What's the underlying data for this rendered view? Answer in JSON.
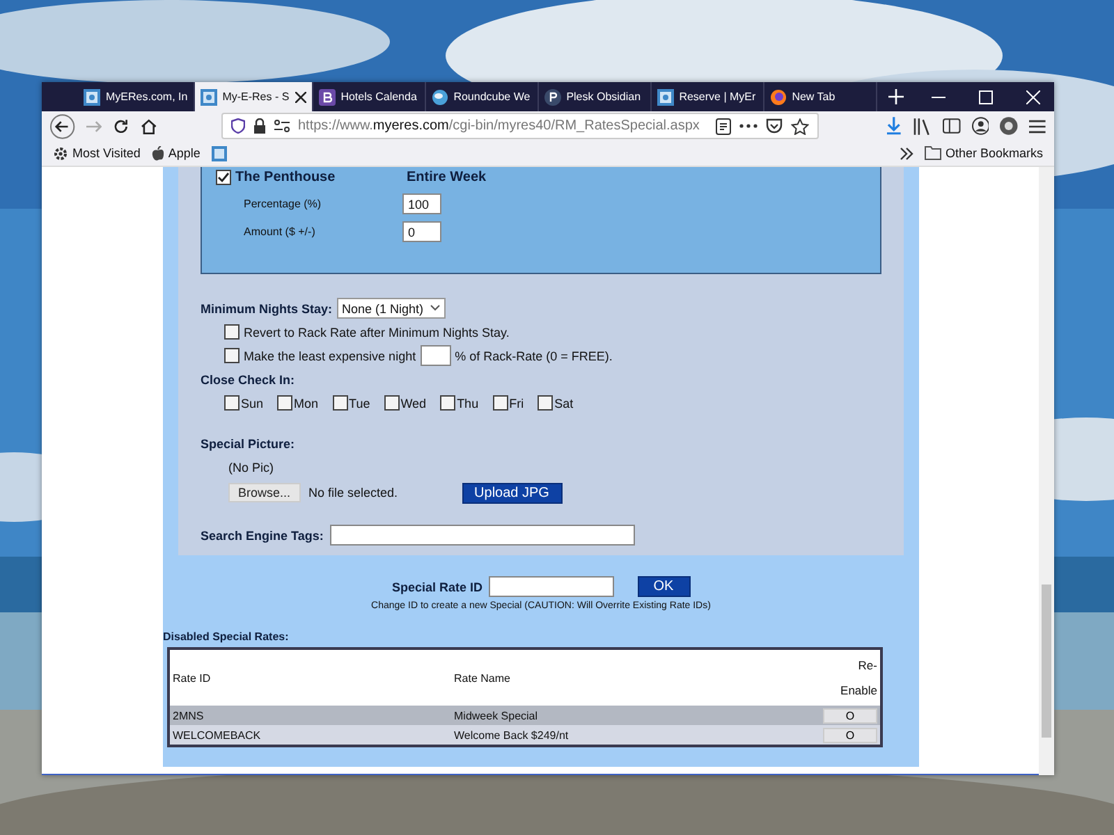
{
  "tabs": [
    {
      "title": "MyERes.com, In",
      "kind": "page",
      "selected": false
    },
    {
      "title": "My-E-Res - S",
      "kind": "page",
      "selected": true
    },
    {
      "title": "Hotels Calenda",
      "kind": "letter-b",
      "selected": false
    },
    {
      "title": "Roundcube We",
      "kind": "globe",
      "selected": false
    },
    {
      "title": "Plesk Obsidian",
      "kind": "letter-p",
      "selected": false
    },
    {
      "title": "Reserve | MyEr",
      "kind": "page",
      "selected": false
    },
    {
      "title": "New Tab",
      "kind": "fox",
      "selected": false
    }
  ],
  "address": {
    "scheme": "https://www.",
    "domain": "myeres.com",
    "path": "/cgi-bin/myres40/RM_RatesSpecial.aspx"
  },
  "bookmarks": [
    {
      "label": "Most Visited",
      "kind": "gear"
    },
    {
      "label": "Apple",
      "kind": "apple"
    }
  ],
  "other_bookmarks": "Other Bookmarks",
  "penthouse": {
    "label": "The Penthouse",
    "checked": true,
    "period": "Entire Week",
    "fields": [
      {
        "label": "Percentage (%)",
        "value": "100"
      },
      {
        "label": "Amount ($ +/-)",
        "value": "0"
      }
    ]
  },
  "min_nights": {
    "label": "Minimum Nights Stay:",
    "value": "None (1 Night)"
  },
  "revert": {
    "label": "Revert to Rack Rate after Minimum Nights Stay.",
    "checked": false
  },
  "least_night": {
    "label": "Make the least expensive night",
    "suffix": "% of Rack-Rate (0 = FREE).",
    "checked": false
  },
  "close_check_in": {
    "label": "Close Check In:",
    "days": [
      {
        "label": "Sun",
        "checked": false
      },
      {
        "label": "Mon",
        "checked": false
      },
      {
        "label": "Tue",
        "checked": false
      },
      {
        "label": "Wed",
        "checked": false
      },
      {
        "label": "Thu",
        "checked": false
      },
      {
        "label": "Fri",
        "checked": false
      },
      {
        "label": "Sat",
        "checked": false
      }
    ]
  },
  "special_picture": {
    "label": "Special Picture:",
    "status": "(No Pic)",
    "browse": "Browse...",
    "file_status": "No file selected.",
    "upload": "Upload JPG"
  },
  "search_tags": {
    "label": "Search Engine Tags:"
  },
  "special_rate_id": {
    "label": "Special Rate ID",
    "ok": "OK",
    "note": "Change ID to create a new Special (CAUTION: Will Overrite Existing Rate IDs)"
  },
  "disabled_rates": {
    "title": "Disabled Special Rates:",
    "columns": [
      "Rate ID",
      "Rate Name",
      "Re-Enable"
    ],
    "rows": [
      {
        "rate_id": "2MNS",
        "rate_name": "Midweek Special",
        "action": "O"
      },
      {
        "rate_id": "WELCOMEBACK",
        "rate_name": "Welcome Back $249/nt",
        "action": "O"
      }
    ]
  }
}
